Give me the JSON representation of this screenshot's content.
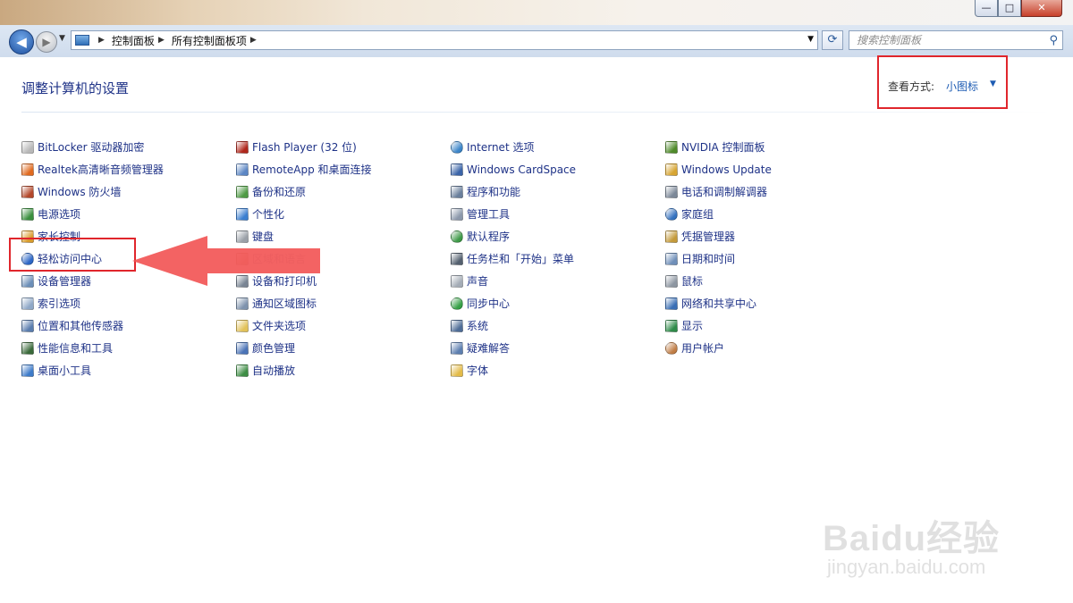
{
  "window": {
    "minimize_glyph": "—",
    "maximize_glyph": "□",
    "close_glyph": "✕"
  },
  "navigation": {
    "back_glyph": "◀",
    "forward_glyph": "▶",
    "breadcrumb": [
      "控制面板",
      "所有控制面板项"
    ],
    "search_placeholder": "搜索控制面板"
  },
  "page": {
    "title": "调整计算机的设置",
    "view_by_label": "查看方式:",
    "view_by_value": "小图标"
  },
  "columns": [
    [
      {
        "label": "BitLocker 驱动器加密",
        "icon": "bitlocker-icon",
        "color": "#b8b8b8"
      },
      {
        "label": "Realtek高清晰音频管理器",
        "icon": "realtek-audio-icon",
        "color": "#e06a1f"
      },
      {
        "label": "Windows 防火墙",
        "icon": "firewall-icon",
        "color": "#b3472a"
      },
      {
        "label": "电源选项",
        "icon": "power-options-icon",
        "color": "#3a8f3e"
      },
      {
        "label": "家长控制",
        "icon": "parental-controls-icon",
        "color": "#d99a2b"
      },
      {
        "label": "轻松访问中心",
        "icon": "ease-of-access-icon",
        "color": "#2d67c6",
        "round": true
      },
      {
        "label": "设备管理器",
        "icon": "device-manager-icon",
        "color": "#6c8fb8"
      },
      {
        "label": "索引选项",
        "icon": "indexing-options-icon",
        "color": "#8fa8c7"
      },
      {
        "label": "位置和其他传感器",
        "icon": "location-sensors-icon",
        "color": "#5a7dae"
      },
      {
        "label": "性能信息和工具",
        "icon": "performance-icon",
        "color": "#3a6a3a"
      },
      {
        "label": "桌面小工具",
        "icon": "desktop-gadgets-icon",
        "color": "#3d7bc9"
      }
    ],
    [
      {
        "label": "Flash Player (32 位)",
        "icon": "flash-player-icon",
        "color": "#b0271c"
      },
      {
        "label": "RemoteApp 和桌面连接",
        "icon": "remoteapp-icon",
        "color": "#5b86c4"
      },
      {
        "label": "备份和还原",
        "icon": "backup-restore-icon",
        "color": "#4f9b45"
      },
      {
        "label": "个性化",
        "icon": "personalization-icon",
        "color": "#3c7fd0"
      },
      {
        "label": "键盘",
        "icon": "keyboard-icon",
        "color": "#9aa0a8"
      },
      {
        "label": "区域和语言",
        "icon": "region-language-icon",
        "color": "#c9a080",
        "faded": true
      },
      {
        "label": "设备和打印机",
        "icon": "devices-printers-icon",
        "color": "#7a8594"
      },
      {
        "label": "通知区域图标",
        "icon": "notification-icons-icon",
        "color": "#7f93ad"
      },
      {
        "label": "文件夹选项",
        "icon": "folder-options-icon",
        "color": "#e2c25a"
      },
      {
        "label": "颜色管理",
        "icon": "color-management-icon",
        "color": "#4b74b7"
      },
      {
        "label": "自动播放",
        "icon": "autoplay-icon",
        "color": "#3e8e45"
      }
    ],
    [
      {
        "label": "Internet 选项",
        "icon": "internet-options-icon",
        "color": "#3d86c9",
        "round": true
      },
      {
        "label": "Windows CardSpace",
        "icon": "cardspace-icon",
        "color": "#3b64a8"
      },
      {
        "label": "程序和功能",
        "icon": "programs-features-icon",
        "color": "#6a7f9c"
      },
      {
        "label": "管理工具",
        "icon": "admin-tools-icon",
        "color": "#8b98ab"
      },
      {
        "label": "默认程序",
        "icon": "default-programs-icon",
        "color": "#3f9a48",
        "round": true
      },
      {
        "label": "任务栏和「开始」菜单",
        "icon": "taskbar-icon",
        "color": "#54606f"
      },
      {
        "label": "声音",
        "icon": "sound-icon",
        "color": "#a4acb6"
      },
      {
        "label": "同步中心",
        "icon": "sync-center-icon",
        "color": "#36a046",
        "round": true
      },
      {
        "label": "系统",
        "icon": "system-icon",
        "color": "#4f6d97"
      },
      {
        "label": "疑难解答",
        "icon": "troubleshooting-icon",
        "color": "#5d7fb0"
      },
      {
        "label": "字体",
        "icon": "fonts-icon",
        "color": "#e3bb48"
      }
    ],
    [
      {
        "label": "NVIDIA 控制面板",
        "icon": "nvidia-icon",
        "color": "#4f8a2a"
      },
      {
        "label": "Windows Update",
        "icon": "windows-update-icon",
        "color": "#d7a532"
      },
      {
        "label": "电话和调制解调器",
        "icon": "phone-modem-icon",
        "color": "#7c8898"
      },
      {
        "label": "家庭组",
        "icon": "homegroup-icon",
        "color": "#3673c0",
        "round": true
      },
      {
        "label": "凭据管理器",
        "icon": "credential-manager-icon",
        "color": "#c49a3a"
      },
      {
        "label": "日期和时间",
        "icon": "date-time-icon",
        "color": "#6f8fb9"
      },
      {
        "label": "鼠标",
        "icon": "mouse-icon",
        "color": "#8d96a1"
      },
      {
        "label": "网络和共享中心",
        "icon": "network-sharing-icon",
        "color": "#3a6fb5"
      },
      {
        "label": "显示",
        "icon": "display-icon",
        "color": "#2f8b49"
      },
      {
        "label": "用户帐户",
        "icon": "user-accounts-icon",
        "color": "#c17e46",
        "round": true
      }
    ]
  ],
  "watermark": {
    "logo": "Baidu经验",
    "url": "jingyan.baidu.com"
  }
}
